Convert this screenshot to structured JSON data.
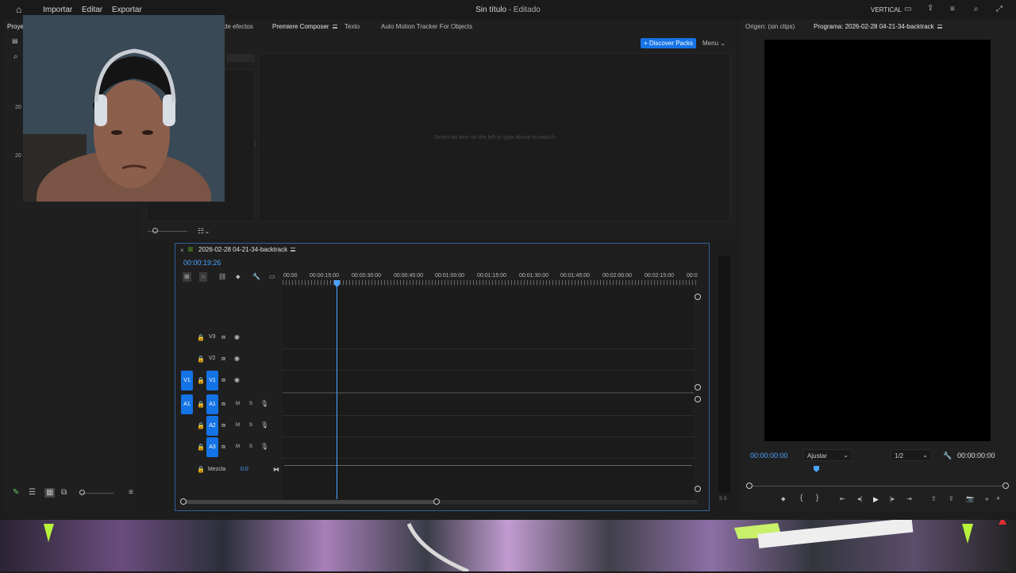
{
  "menu": {
    "importar": "Importar",
    "editar": "Editar",
    "exportar": "Exportar"
  },
  "header": {
    "title": "Sin título",
    "status": "- Editado",
    "workspace": "VERTICAL"
  },
  "left_panel": {
    "tab_truncated": "Proye",
    "tab_effects_truncated": "de efectos",
    "row1": "20",
    "row2": "20"
  },
  "composer": {
    "tabs": [
      "Premiere Composer",
      "Texto",
      "Auto Motion Tracker For Objects"
    ],
    "discover_button": "+ Discover Packs",
    "menu_label": "Menu",
    "empty_message": "Select an item on the left or type above to search."
  },
  "timeline": {
    "sequence_name": "2026-02-28 04-21-34-backtrack",
    "timecode": "00:00:19:26",
    "ruler": [
      "00:00",
      "00:00:15:00",
      "00:00:30:00",
      "00:00:45:00",
      "00:01:00:00",
      "00:01:15:00",
      "00:01:30:00",
      "00:01:45:00",
      "00:02:00:00",
      "00:02:15:00",
      "00:0"
    ],
    "video_tracks": [
      "V3",
      "V2",
      "V1"
    ],
    "audio_tracks": [
      "A1",
      "A2",
      "A3"
    ],
    "source_v": "V1",
    "source_a": "A1",
    "mute": "M",
    "solo": "S",
    "mix_label": "Mezcla",
    "mix_value": "0.0",
    "meter_labels": "S S"
  },
  "program": {
    "source_tab": "Origen: (sin clips)",
    "program_tab": "Programa: 2026-02-28 04-21-34-backtrack",
    "timecode_left": "00:00:00:00",
    "fit": "Ajustar",
    "resolution": "1/2",
    "timecode_right": "00:00:00:00"
  },
  "colors": {
    "accent": "#1473e6",
    "timecode": "#4aa3ff",
    "panel": "#1f1f1f"
  }
}
